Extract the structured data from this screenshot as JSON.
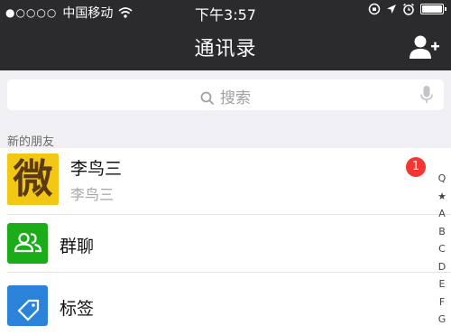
{
  "status_bar": {
    "signal": "●○○○○",
    "carrier": "中国移动",
    "time": "下午3:57"
  },
  "nav": {
    "title": "通讯录",
    "add_icon": "add-contact-icon"
  },
  "search": {
    "placeholder": "搜索",
    "icon": "search-icon",
    "voice_icon": "microphone-icon"
  },
  "section": {
    "title": "新的朋友"
  },
  "new_friend": {
    "avatar_text": "微",
    "name": "李鸟三",
    "subtitle": "李鸟三",
    "badge": "1"
  },
  "items": [
    {
      "label": "群聊",
      "icon": "group-chat-icon",
      "color": "#1aad19"
    },
    {
      "label": "标签",
      "icon": "tag-icon",
      "color": "#2b82d9"
    }
  ],
  "index_letters": [
    "Q",
    "★",
    "A",
    "B",
    "C",
    "D",
    "E",
    "F",
    "G"
  ],
  "colors": {
    "nav_bg": "#2b2b2e",
    "badge": "#f43531"
  }
}
